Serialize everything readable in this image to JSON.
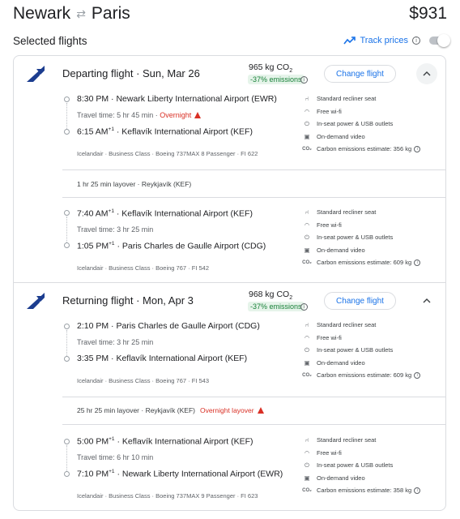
{
  "header": {
    "origin": "Newark",
    "destination": "Paris",
    "price": "$931"
  },
  "selected": {
    "title": "Selected flights",
    "track_label": "Track prices"
  },
  "amenity_labels": {
    "seat": "Standard recliner seat",
    "wifi": "Free wi-fi",
    "power": "In-seat power & USB outlets",
    "video": "On-demand video"
  },
  "departing": {
    "title": "Departing flight",
    "date": "Sun, Mar 26",
    "co2": "965 kg CO",
    "co2_sub": "2",
    "emissions_badge": "-37% emissions",
    "change_label": "Change flight",
    "segments": [
      {
        "dep_time": "8:30 PM",
        "dep_airport": "Newark Liberty International Airport (EWR)",
        "travel_time": "Travel time: 5 hr 45 min",
        "overnight": "Overnight",
        "arr_time": "6:15 AM",
        "arr_sup": "+1",
        "arr_airport": "Keflavík International Airport (KEF)",
        "details": "Icelandair · Business Class · Boeing 737MAX 8 Passenger · FI 622",
        "carbon": "Carbon emissions estimate: 356 kg"
      },
      {
        "dep_time": "7:40 AM",
        "dep_sup": "+1",
        "dep_airport": "Keflavík International Airport (KEF)",
        "travel_time": "Travel time: 3 hr 25 min",
        "arr_time": "1:05 PM",
        "arr_sup": "+1",
        "arr_airport": "Paris Charles de Gaulle Airport (CDG)",
        "details": "Icelandair · Business Class · Boeing 767 · FI 542",
        "carbon": "Carbon emissions estimate: 609 kg"
      }
    ],
    "layover": "1 hr 25 min layover · Reykjavík (KEF)"
  },
  "returning": {
    "title": "Returning flight",
    "date": "Mon, Apr 3",
    "co2": "968 kg CO",
    "co2_sub": "2",
    "emissions_badge": "-37% emissions",
    "change_label": "Change flight",
    "segments": [
      {
        "dep_time": "2:10 PM",
        "dep_airport": "Paris Charles de Gaulle Airport (CDG)",
        "travel_time": "Travel time: 3 hr 25 min",
        "arr_time": "3:35 PM",
        "arr_airport": "Keflavík International Airport (KEF)",
        "details": "Icelandair · Business Class · Boeing 767 · FI 543",
        "carbon": "Carbon emissions estimate: 609 kg"
      },
      {
        "dep_time": "5:00 PM",
        "dep_sup": "+1",
        "dep_airport": "Keflavík International Airport (KEF)",
        "travel_time": "Travel time: 6 hr 10 min",
        "arr_time": "7:10 PM",
        "arr_sup": "+1",
        "arr_airport": "Newark Liberty International Airport (EWR)",
        "details": "Icelandair · Business Class · Boeing 737MAX 9 Passenger · FI 623",
        "carbon": "Carbon emissions estimate: 358 kg"
      }
    ],
    "layover": "25 hr 25 min layover · Reykjavík (KEF)",
    "layover_warning": "Overnight layover"
  },
  "colors": {
    "accent": "#1a73e8",
    "warning": "#d93025",
    "green": "#188038",
    "logo": "#1c3d8f"
  },
  "icons": {
    "swap": "swap-arrows-icon",
    "trend": "trending-icon",
    "airline": "icelandair-logo-icon",
    "seat": "seat-icon",
    "wifi": "wifi-icon",
    "power": "power-plug-icon",
    "video": "video-icon",
    "co2": "co2-icon",
    "warning": "warning-icon",
    "chevron": "chevron-up-icon"
  }
}
